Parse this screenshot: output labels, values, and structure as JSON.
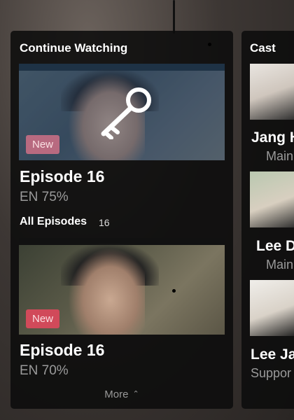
{
  "continue_watching": {
    "title": "Continue Watching",
    "items": [
      {
        "badge": "New",
        "episode": "Episode 16",
        "progress": "EN 75%"
      },
      {
        "badge": "New",
        "episode": "Episode 16",
        "progress": "EN 70%"
      }
    ],
    "all_episodes_label": "All Episodes",
    "all_episodes_count": "16",
    "more_label": "More"
  },
  "cast": {
    "title": "Cast",
    "members": [
      {
        "name": "Jang H",
        "role": "Main"
      },
      {
        "name": "Lee D",
        "role": "Main"
      },
      {
        "name": "Lee Ja",
        "role": "Suppor"
      }
    ]
  },
  "icons": {
    "thumb_overlay": "key-icon",
    "more_chevron": "chevron-up-icon"
  },
  "colors": {
    "badge_new": "#d14a5a",
    "panel_bg": "#0c0c0c"
  }
}
